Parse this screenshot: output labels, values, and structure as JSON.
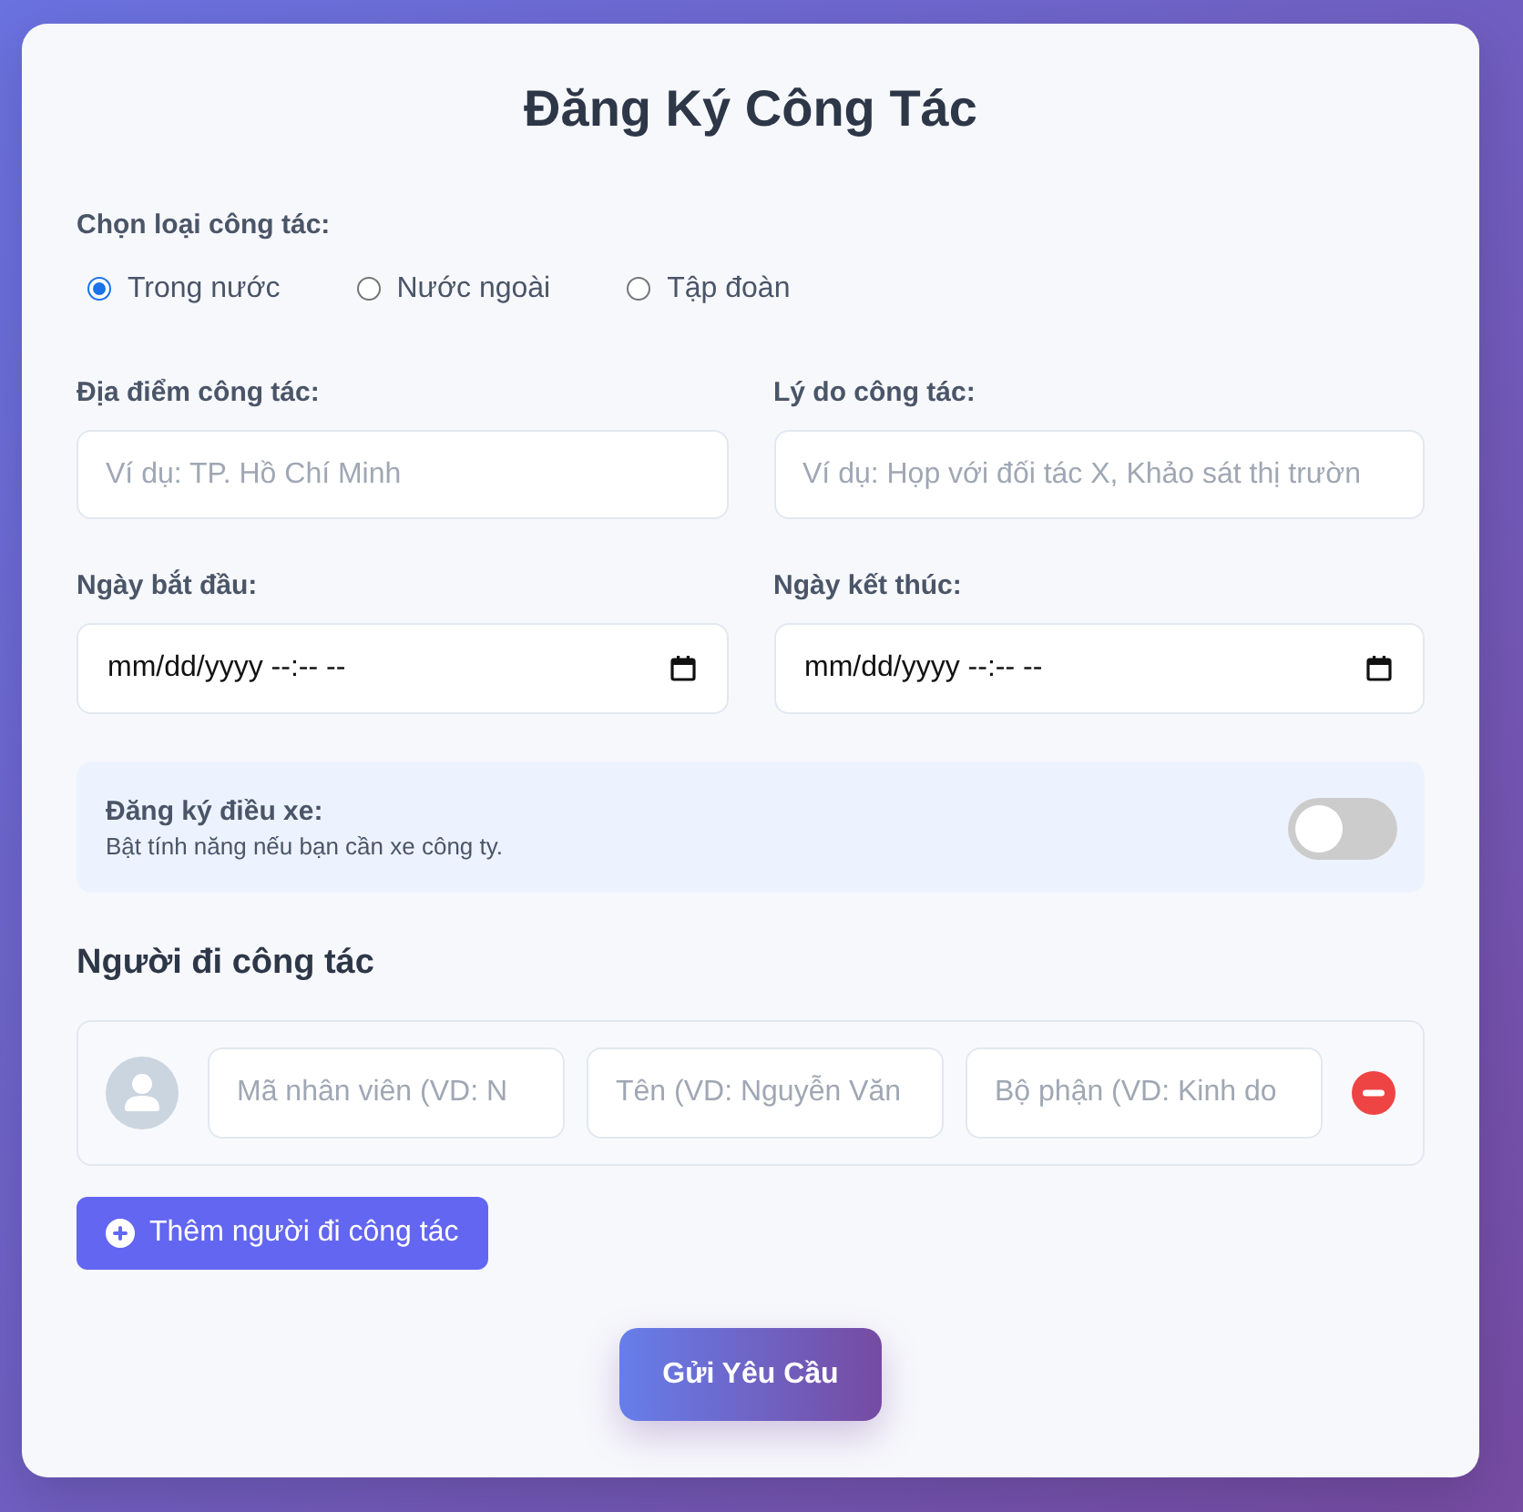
{
  "title": "Đăng Ký Công Tác",
  "trip_type": {
    "label": "Chọn loại công tác:",
    "options": [
      {
        "label": "Trong nước",
        "selected": true
      },
      {
        "label": "Nước ngoài",
        "selected": false
      },
      {
        "label": "Tập đoàn",
        "selected": false
      }
    ]
  },
  "fields": [
    {
      "kind": "text",
      "label": "Địa điểm công tác:",
      "placeholder": "Ví dụ: TP. Hồ Chí Minh"
    },
    {
      "kind": "text",
      "label": "Lý do công tác:",
      "placeholder": "Ví dụ: Họp với đối tác X, Khảo sát thị trườn"
    },
    {
      "kind": "datetime",
      "label": "Ngày bắt đầu:",
      "placeholder": "mm/dd/yyyy --:-- --"
    },
    {
      "kind": "datetime",
      "label": "Ngày kết thúc:",
      "placeholder": "mm/dd/yyyy --:-- --"
    }
  ],
  "vehicle": {
    "title": "Đăng ký điều xe:",
    "description": "Bật tính năng nếu bạn cần xe công ty.",
    "on": false
  },
  "travelers": {
    "heading": "Người đi công tác",
    "rows": [
      {
        "fields": [
          {
            "placeholder": "Mã nhân viên (VD: N"
          },
          {
            "placeholder": "Tên (VD: Nguyễn Văn"
          },
          {
            "placeholder": "Bộ phận (VD: Kinh do"
          }
        ]
      }
    ],
    "add_button": "Thêm người đi công tác"
  },
  "submit_button": "Gửi Yêu Cầu"
}
